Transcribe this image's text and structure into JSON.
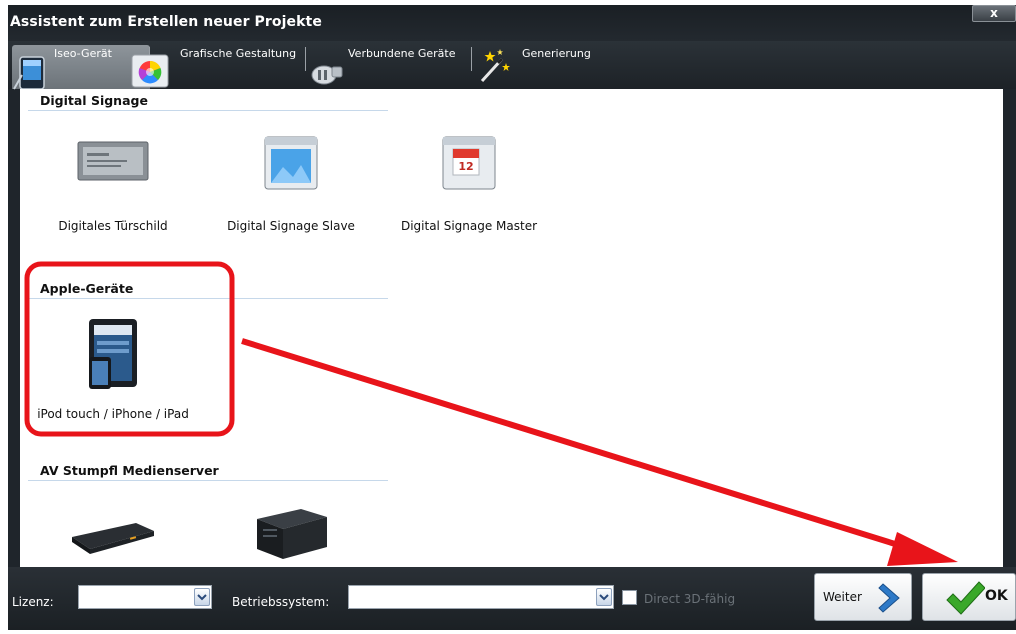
{
  "window": {
    "title": "Assistent zum Erstellen neuer Projekte",
    "close_label": "x"
  },
  "tabs": [
    {
      "label": "Iseo-Gerät",
      "icon": "pda-icon",
      "selected": true
    },
    {
      "label": "Grafische Gestaltung",
      "icon": "color-wheel-icon",
      "selected": false
    },
    {
      "label": "Verbundene Geräte",
      "icon": "plug-icon",
      "selected": false
    },
    {
      "label": "Generierung",
      "icon": "magic-wand-icon",
      "selected": false
    }
  ],
  "sections": {
    "digital_signage": {
      "title": "Digital Signage",
      "items": [
        {
          "label": "Digitales Türschild",
          "icon": "door-sign-icon"
        },
        {
          "label": "Digital Signage Slave",
          "icon": "display-window-icon"
        },
        {
          "label": "Digital Signage Master",
          "icon": "calendar-window-icon"
        }
      ]
    },
    "apple": {
      "title": "Apple-Geräte",
      "items": [
        {
          "label": "iPod touch / iPhone / iPad",
          "icon": "ipad-iphone-icon"
        }
      ]
    },
    "av_stumpfl": {
      "title": "AV Stumpfl Medienserver",
      "items": [
        {
          "label": "",
          "icon": "rack-server-icon"
        },
        {
          "label": "",
          "icon": "case-server-icon"
        }
      ]
    }
  },
  "bottom": {
    "license_label": "Lizenz:",
    "license_value": "",
    "os_label": "Betriebssystem:",
    "os_value": "",
    "direct3d_label": "Direct 3D-fähig",
    "direct3d_checked": false,
    "next_label": "Weiter",
    "ok_label": "OK"
  },
  "colors": {
    "window_dark": "#1f252b",
    "highlight_red": "#e8141a",
    "ok_check_green": "#3aa82a",
    "next_arrow_blue": "#2d79c7"
  }
}
